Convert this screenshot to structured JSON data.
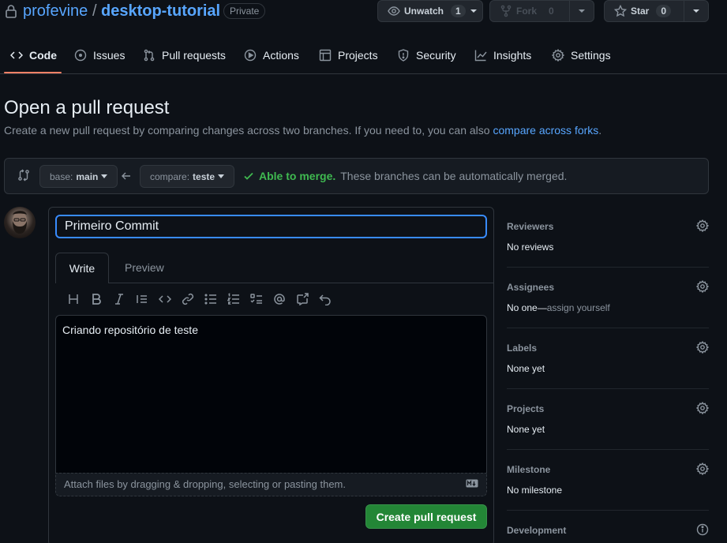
{
  "repo": {
    "owner": "profevine",
    "separator": "/",
    "name": "desktop-tutorial",
    "visibility": "Private"
  },
  "header_buttons": {
    "watch": {
      "label": "Unwatch",
      "count": "1"
    },
    "fork": {
      "label": "Fork",
      "count": "0"
    },
    "star": {
      "label": "Star",
      "count": "0"
    }
  },
  "nav": {
    "tabs": [
      {
        "label": "Code",
        "icon": "code-icon",
        "active": true
      },
      {
        "label": "Issues",
        "icon": "issue-icon"
      },
      {
        "label": "Pull requests",
        "icon": "pull-request-icon"
      },
      {
        "label": "Actions",
        "icon": "play-icon"
      },
      {
        "label": "Projects",
        "icon": "table-icon"
      },
      {
        "label": "Security",
        "icon": "shield-icon"
      },
      {
        "label": "Insights",
        "icon": "graph-icon"
      },
      {
        "label": "Settings",
        "icon": "gear-icon"
      }
    ]
  },
  "page": {
    "title": "Open a pull request",
    "subtitle": "Create a new pull request by comparing changes across two branches. If you need to, you can also ",
    "subtitle_link": "compare across forks",
    "subtitle_end": "."
  },
  "compare": {
    "base_prefix": "base:",
    "base_value": "main",
    "compare_prefix": "compare:",
    "compare_value": "teste",
    "merge_status": "Able to merge.",
    "merge_message": "These branches can be automatically merged."
  },
  "form": {
    "title_value": "Primeiro Commit",
    "write_tab": "Write",
    "preview_tab": "Preview",
    "body_value": "Criando repositório de teste",
    "attach_hint": "Attach files by dragging & dropping, selecting or pasting them.",
    "submit_label": "Create pull request"
  },
  "sidebar": {
    "reviewers": {
      "heading": "Reviewers",
      "value": "No reviews"
    },
    "assignees": {
      "heading": "Assignees",
      "value": "No one—",
      "link": "assign yourself"
    },
    "labels": {
      "heading": "Labels",
      "value": "None yet"
    },
    "projects": {
      "heading": "Projects",
      "value": "None yet"
    },
    "milestone": {
      "heading": "Milestone",
      "value": "No milestone"
    },
    "development": {
      "heading": "Development"
    }
  },
  "colors": {
    "background": "#0d1117",
    "link": "#58a6ff",
    "success": "#3fb950",
    "primary_button": "#238636",
    "active_tab_underline": "#f78166"
  }
}
